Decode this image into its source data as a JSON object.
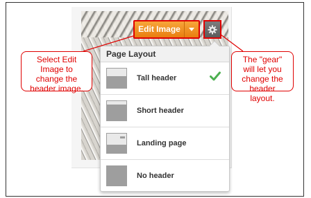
{
  "toolbar": {
    "edit_image_label": "Edit Image"
  },
  "menu": {
    "title": "Page Layout",
    "items": [
      {
        "label": "Tall header",
        "selected": true,
        "thumb": "tall-header-thumb-icon"
      },
      {
        "label": "Short header",
        "selected": false,
        "thumb": "short-header-thumb-icon"
      },
      {
        "label": "Landing page",
        "selected": false,
        "thumb": "landing-page-thumb-icon"
      },
      {
        "label": "No header",
        "selected": false,
        "thumb": "no-header-thumb-icon"
      }
    ]
  },
  "callouts": {
    "left": "Select Edit Image to change the header image.",
    "right": "The \"gear\" will let you change the header layout."
  },
  "colors": {
    "accent_orange": "#f7a63a",
    "highlight_red": "#e00000",
    "check_green": "#4caf50"
  }
}
